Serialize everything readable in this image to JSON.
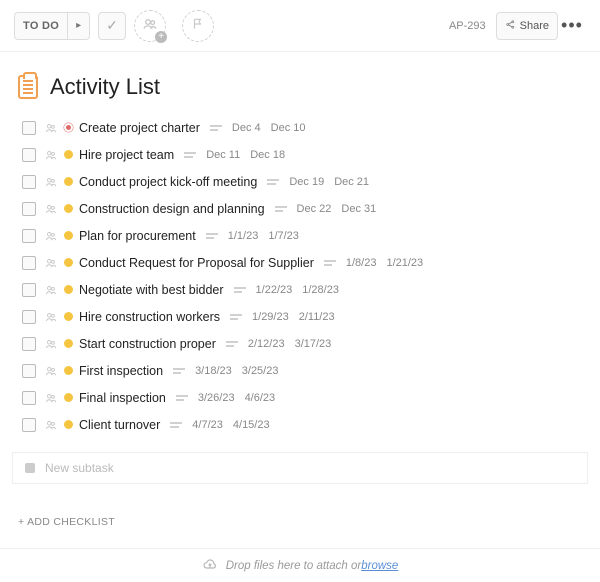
{
  "toolbar": {
    "status_label": "TO DO",
    "next_glyph": "▸",
    "check_glyph": "✓",
    "people_glyph": "",
    "flag_glyph": "",
    "id": "AP-293",
    "share_label": "Share",
    "more_glyph": "•••"
  },
  "title": "Activity List",
  "tasks": [
    {
      "status": "red",
      "title": "Create project charter",
      "d1": "Dec 4",
      "d2": "Dec 10"
    },
    {
      "status": "yellow",
      "title": "Hire project team",
      "d1": "Dec 11",
      "d2": "Dec 18"
    },
    {
      "status": "yellow",
      "title": "Conduct project kick-off meeting",
      "d1": "Dec 19",
      "d2": "Dec 21"
    },
    {
      "status": "yellow",
      "title": "Construction design and planning",
      "d1": "Dec 22",
      "d2": "Dec 31"
    },
    {
      "status": "yellow",
      "title": "Plan for procurement",
      "d1": "1/1/23",
      "d2": "1/7/23"
    },
    {
      "status": "yellow",
      "title": "Conduct Request for Proposal for Supplier",
      "d1": "1/8/23",
      "d2": "1/21/23"
    },
    {
      "status": "yellow",
      "title": "Negotiate with best bidder",
      "d1": "1/22/23",
      "d2": "1/28/23"
    },
    {
      "status": "yellow",
      "title": "Hire construction workers",
      "d1": "1/29/23",
      "d2": "2/11/23"
    },
    {
      "status": "yellow",
      "title": "Start construction proper",
      "d1": "2/12/23",
      "d2": "3/17/23"
    },
    {
      "status": "yellow",
      "title": "First inspection",
      "d1": "3/18/23",
      "d2": "3/25/23"
    },
    {
      "status": "yellow",
      "title": "Final inspection",
      "d1": "3/26/23",
      "d2": "4/6/23"
    },
    {
      "status": "yellow",
      "title": "Client turnover",
      "d1": "4/7/23",
      "d2": "4/15/23"
    }
  ],
  "new_subtask_placeholder": "New subtask",
  "add_checklist_label": "+ ADD CHECKLIST",
  "dropzone": {
    "text": "Drop files here to attach or ",
    "link": "browse"
  }
}
